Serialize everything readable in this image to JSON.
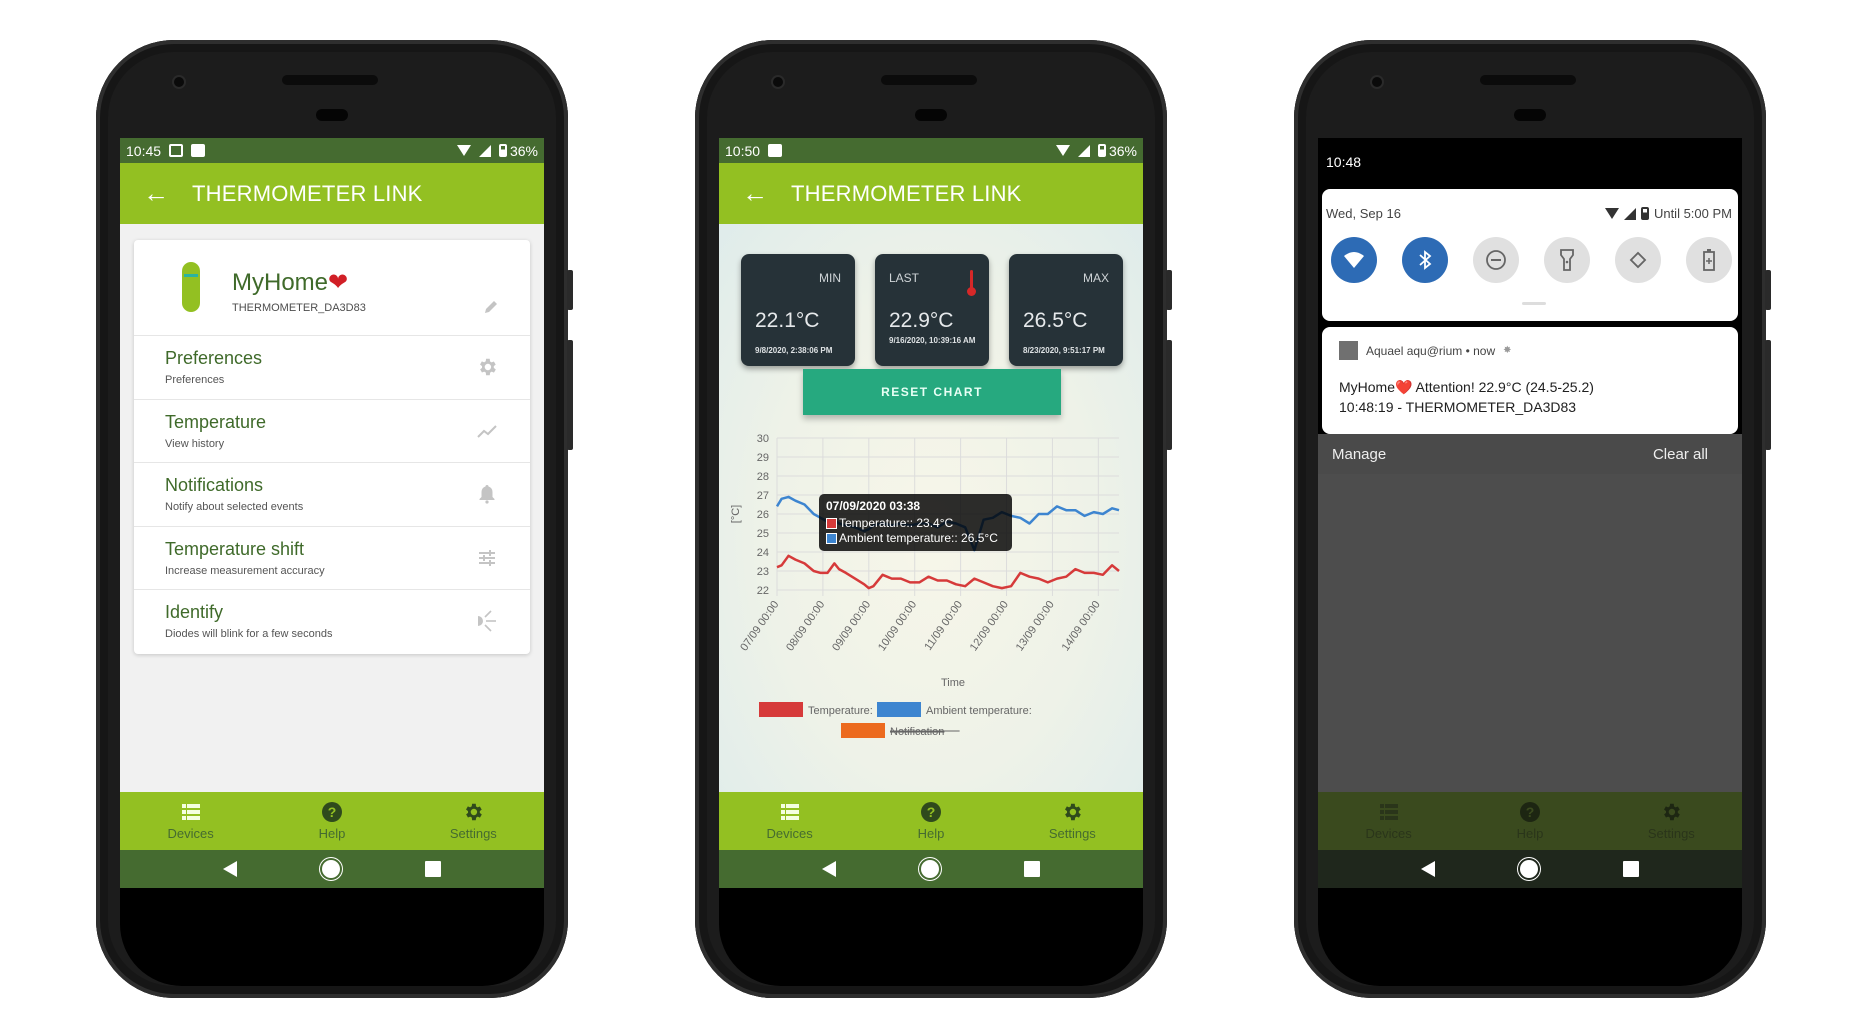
{
  "app": {
    "title": "THERMOMETER LINK",
    "brand_color": "#93c022",
    "status_color": "#456b30"
  },
  "phone1": {
    "status": {
      "time": "10:45",
      "battery": "36%",
      "icons": [
        "gmail-icon",
        "shopping-bag-icon",
        "wifi-icon",
        "signal-icon",
        "battery-icon"
      ]
    },
    "device": {
      "name": "MyHome",
      "name_emoji": "❤️",
      "id": "THERMOMETER_DA3D83"
    },
    "menu": [
      {
        "title": "Preferences",
        "subtitle": "Preferences",
        "icon": "gear-icon"
      },
      {
        "title": "Temperature",
        "subtitle": "View history",
        "icon": "trend-icon"
      },
      {
        "title": "Notifications",
        "subtitle": "Notify about selected events",
        "icon": "bell-icon"
      },
      {
        "title": "Temperature shift",
        "subtitle": "Increase measurement accuracy",
        "icon": "tune-icon"
      },
      {
        "title": "Identify",
        "subtitle": "Diodes will blink for a few seconds",
        "icon": "blink-icon"
      }
    ]
  },
  "bottom_nav": [
    {
      "label": "Devices",
      "icon": "list-icon"
    },
    {
      "label": "Help",
      "icon": "help-icon"
    },
    {
      "label": "Settings",
      "icon": "gear-icon"
    }
  ],
  "phone2": {
    "status": {
      "time": "10:50",
      "battery": "36%"
    },
    "stats": [
      {
        "label": "MIN",
        "value": "22.1°C",
        "timestamp": "9/8/2020, 2:38:06 PM"
      },
      {
        "label": "LAST",
        "value": "22.9°C",
        "timestamp": "9/16/2020, 10:39:16 AM"
      },
      {
        "label": "MAX",
        "value": "26.5°C",
        "timestamp": "8/23/2020, 9:51:17 PM"
      }
    ],
    "reset_label": "RESET CHART",
    "tooltip": {
      "title": "07/09/2020 03:38",
      "rows": [
        {
          "label": "Temperature:: 23.4°C",
          "color": "#d63a3a"
        },
        {
          "label": "Ambient temperature:: 26.5°C",
          "color": "#3d85d0"
        }
      ]
    }
  },
  "chart_data": {
    "type": "line",
    "title": "",
    "xlabel": "Time",
    "ylabel": "[°C]",
    "ylim": [
      22,
      30
    ],
    "yticks": [
      22,
      23,
      24,
      25,
      26,
      27,
      28,
      29,
      30
    ],
    "xticks": [
      "07/09 00:00",
      "08/09 00:00",
      "09/09 00:00",
      "10/09 00:00",
      "11/09 00:00",
      "12/09 00:00",
      "13/09 00:00",
      "14/09 00:00"
    ],
    "xrange_days": [
      0,
      7.45
    ],
    "grid": true,
    "legend": {
      "placement": "bottom",
      "entries": [
        {
          "name": "Temperature:",
          "color": "#d63a3a",
          "hidden": false
        },
        {
          "name": "Ambient temperature:",
          "color": "#3d85d0",
          "hidden": false
        },
        {
          "name": "Notification",
          "color": "#ec6a1e",
          "hidden": true
        }
      ]
    },
    "series": [
      {
        "name": "Temperature",
        "color": "#d63a3a",
        "x": [
          0,
          0.1,
          0.25,
          0.4,
          0.6,
          0.8,
          0.95,
          1.1,
          1.25,
          1.35,
          1.5,
          1.7,
          1.9,
          2.0,
          2.1,
          2.3,
          2.5,
          2.7,
          2.9,
          3.1,
          3.3,
          3.5,
          3.7,
          3.9,
          4.1,
          4.3,
          4.5,
          4.7,
          4.9,
          5.1,
          5.3,
          5.5,
          5.7,
          5.9,
          6.1,
          6.3,
          6.5,
          6.7,
          6.9,
          7.1,
          7.3,
          7.45
        ],
        "y": [
          23.2,
          23.3,
          23.8,
          23.6,
          23.4,
          23.0,
          22.9,
          22.9,
          23.4,
          23.1,
          22.9,
          22.6,
          22.3,
          22.1,
          22.2,
          22.8,
          22.6,
          22.6,
          22.4,
          22.4,
          22.7,
          22.5,
          22.5,
          22.3,
          22.2,
          22.6,
          22.4,
          22.2,
          22.1,
          22.2,
          22.9,
          22.7,
          22.6,
          22.4,
          22.6,
          22.7,
          23.1,
          22.9,
          22.9,
          22.8,
          23.3,
          23.0
        ]
      },
      {
        "name": "Ambient temperature",
        "color": "#3d85d0",
        "x": [
          0,
          0.1,
          0.25,
          0.4,
          0.6,
          0.8,
          0.95,
          1.1,
          1.25,
          1.35,
          1.5,
          1.7,
          1.9,
          2.0,
          2.1,
          2.3,
          2.5,
          2.7,
          2.9,
          3.1,
          3.3,
          3.5,
          3.7,
          3.9,
          4.1,
          4.3,
          4.5,
          4.7,
          4.9,
          5.1,
          5.3,
          5.5,
          5.7,
          5.9,
          6.1,
          6.3,
          6.5,
          6.7,
          6.9,
          7.1,
          7.3,
          7.45
        ],
        "y": [
          26.4,
          26.8,
          26.9,
          26.7,
          26.5,
          26.0,
          25.8,
          25.6,
          25.7,
          25.5,
          25.4,
          25.3,
          25.1,
          25.2,
          25.4,
          25.5,
          25.4,
          25.5,
          25.4,
          25.5,
          25.5,
          25.3,
          25.6,
          25.5,
          25.3,
          24.1,
          25.7,
          25.8,
          26.1,
          25.9,
          25.8,
          25.5,
          26.0,
          26.0,
          26.4,
          26.2,
          26.2,
          25.9,
          26.1,
          26.0,
          26.3,
          26.2
        ]
      }
    ]
  },
  "phone3": {
    "status": {
      "time": "10:48"
    },
    "quick_settings": {
      "date": "Wed, Sep 16",
      "battery_text": "Until 5:00 PM",
      "tiles": [
        {
          "name": "wifi",
          "active": true,
          "glyph": "▼"
        },
        {
          "name": "bluetooth",
          "active": true,
          "glyph": "ᛒ"
        },
        {
          "name": "do-not-disturb",
          "active": false,
          "glyph": "⊖"
        },
        {
          "name": "flashlight",
          "active": false,
          "glyph": "▮"
        },
        {
          "name": "auto-rotate",
          "active": false,
          "glyph": "⟲"
        },
        {
          "name": "battery-saver",
          "active": false,
          "glyph": "▯"
        }
      ]
    },
    "notification": {
      "app": "Aquael aqu@rium • now",
      "line1": "MyHome❤️ Attention! 22.9°C (24.5-25.2)",
      "line2": "10:48:19 - THERMOMETER_DA3D83"
    },
    "actions": {
      "manage": "Manage",
      "clear_all": "Clear all"
    }
  }
}
